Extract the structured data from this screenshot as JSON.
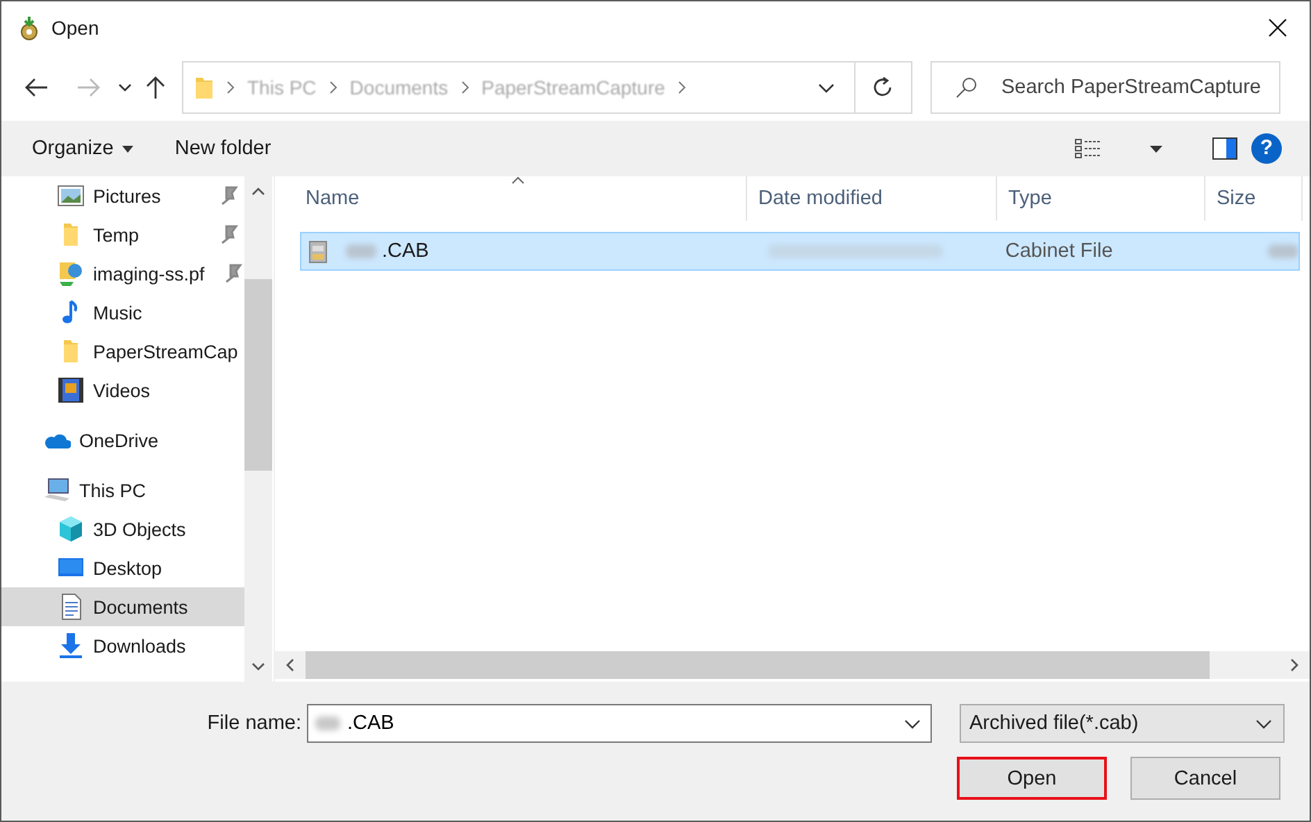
{
  "window": {
    "title": "Open"
  },
  "address_bar": {
    "crumbs": [
      "This PC",
      "Documents",
      "PaperStreamCapture"
    ]
  },
  "search": {
    "placeholder": "Search PaperStreamCapture"
  },
  "toolbar": {
    "organize": "Organize",
    "new_folder": "New folder",
    "help": "?"
  },
  "sidebar": {
    "quick_access": [
      {
        "label": "Pictures",
        "kind": "pictures",
        "pinned": true,
        "selected": false
      },
      {
        "label": "Temp",
        "kind": "folder",
        "pinned": true,
        "selected": false
      },
      {
        "label": "imaging-ss.pf",
        "kind": "network",
        "pinned": true,
        "selected": false
      },
      {
        "label": "Music",
        "kind": "music",
        "pinned": false,
        "selected": false
      },
      {
        "label": "PaperStreamCap",
        "kind": "folder",
        "pinned": false,
        "selected": false
      },
      {
        "label": "Videos",
        "kind": "videos",
        "pinned": false,
        "selected": false
      }
    ],
    "locations": [
      {
        "label": "OneDrive",
        "kind": "cloud",
        "selected": false
      },
      {
        "label": "This PC",
        "kind": "computer",
        "selected": false,
        "children": [
          {
            "label": "3D Objects",
            "kind": "cube",
            "selected": false
          },
          {
            "label": "Desktop",
            "kind": "desktop",
            "selected": false
          },
          {
            "label": "Documents",
            "kind": "document",
            "selected": true
          },
          {
            "label": "Downloads",
            "kind": "download",
            "selected": false
          }
        ]
      }
    ]
  },
  "table": {
    "columns": [
      "Name",
      "Date modified",
      "Type",
      "Size"
    ],
    "rows": [
      {
        "name": ".CAB",
        "name_redacted": true,
        "date_redacted": true,
        "type": "Cabinet File",
        "size_redacted": true,
        "selected": true
      }
    ]
  },
  "file_name": {
    "label": "File name:",
    "value": ".CAB",
    "redacted_prefix": true
  },
  "file_type": {
    "value": "Archived file(*.cab)"
  },
  "buttons": [
    {
      "label": "Open",
      "highlighted": true
    },
    {
      "label": "Cancel",
      "highlighted": false
    }
  ]
}
